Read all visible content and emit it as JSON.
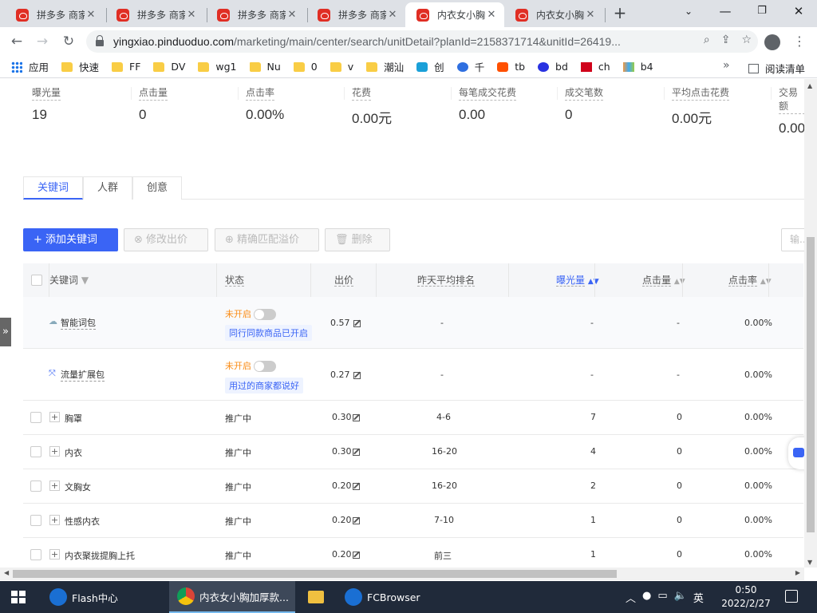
{
  "browser": {
    "tabs": [
      {
        "label": "拼多多 商家"
      },
      {
        "label": "拼多多 商家"
      },
      {
        "label": "拼多多 商家"
      },
      {
        "label": "拼多多 商家"
      },
      {
        "label": "内衣女小胸"
      },
      {
        "label": "内衣女小胸"
      }
    ],
    "active_tab_index": 4,
    "url_host": "yingxiao.pinduoduo.com",
    "url_path": "/marketing/main/center/search/unitDetail?planId=2158371714&unitId=26419...",
    "bookmarks": [
      "应用",
      "快速",
      "FF",
      "DV",
      "wg1",
      "Nu",
      "0",
      "v",
      "潮汕",
      "创",
      "千",
      "tb",
      "bd",
      "ch",
      "b4"
    ],
    "bookmark_more": "»",
    "reading_list": "阅读清单"
  },
  "stats": [
    {
      "label": "曝光量",
      "value": "19"
    },
    {
      "label": "点击量",
      "value": "0"
    },
    {
      "label": "点击率",
      "value": "0.00%"
    },
    {
      "label": "花费",
      "value": "0.00元"
    },
    {
      "label": "每笔成交花费",
      "value": "0.00"
    },
    {
      "label": "成交笔数",
      "value": "0"
    },
    {
      "label": "平均点击花费",
      "value": "0.00元"
    },
    {
      "label": "交易额",
      "value": "0.00"
    }
  ],
  "page_tabs": [
    "关键词",
    "人群",
    "创意"
  ],
  "actions": {
    "add": "+ 添加关键词",
    "modify": "修改出价",
    "precise": "精确匹配溢价",
    "delete": "删除",
    "search_placeholder": "输..."
  },
  "table": {
    "headers": {
      "keyword": "关键词",
      "status": "状态",
      "bid": "出价",
      "rank": "昨天平均排名",
      "impressions": "曝光量",
      "clicks": "点击量",
      "ctr": "点击率"
    },
    "special_rows": [
      {
        "name": "智能词包",
        "status": "未开启",
        "hint": "同行同款商品已开启",
        "bid": "0.57",
        "rank": "-",
        "impressions": "-",
        "clicks": "-",
        "ctr": "0.00%"
      },
      {
        "name": "流量扩展包",
        "status": "未开启",
        "hint": "用过的商家都说好",
        "bid": "0.27",
        "rank": "-",
        "impressions": "-",
        "clicks": "-",
        "ctr": "0.00%"
      }
    ],
    "rows": [
      {
        "name": "胸罩",
        "status": "推广中",
        "bid": "0.30",
        "rank": "4-6",
        "impressions": "7",
        "clicks": "0",
        "ctr": "0.00%"
      },
      {
        "name": "内衣",
        "status": "推广中",
        "bid": "0.30",
        "rank": "16-20",
        "impressions": "4",
        "clicks": "0",
        "ctr": "0.00%"
      },
      {
        "name": "文胸女",
        "status": "推广中",
        "bid": "0.20",
        "rank": "16-20",
        "impressions": "2",
        "clicks": "0",
        "ctr": "0.00%"
      },
      {
        "name": "性感内衣",
        "status": "推广中",
        "bid": "0.20",
        "rank": "7-10",
        "impressions": "1",
        "clicks": "0",
        "ctr": "0.00%"
      },
      {
        "name": "内衣聚拢提胸上托",
        "status": "推广中",
        "bid": "0.20",
        "rank": "前三",
        "impressions": "1",
        "clicks": "0",
        "ctr": "0.00%"
      }
    ]
  },
  "taskbar": {
    "items": [
      "Flash中心",
      "内衣女小胸加厚款...",
      "FCBrowser"
    ],
    "ime": "英",
    "time": "0:50",
    "date": "2022/2/27"
  }
}
